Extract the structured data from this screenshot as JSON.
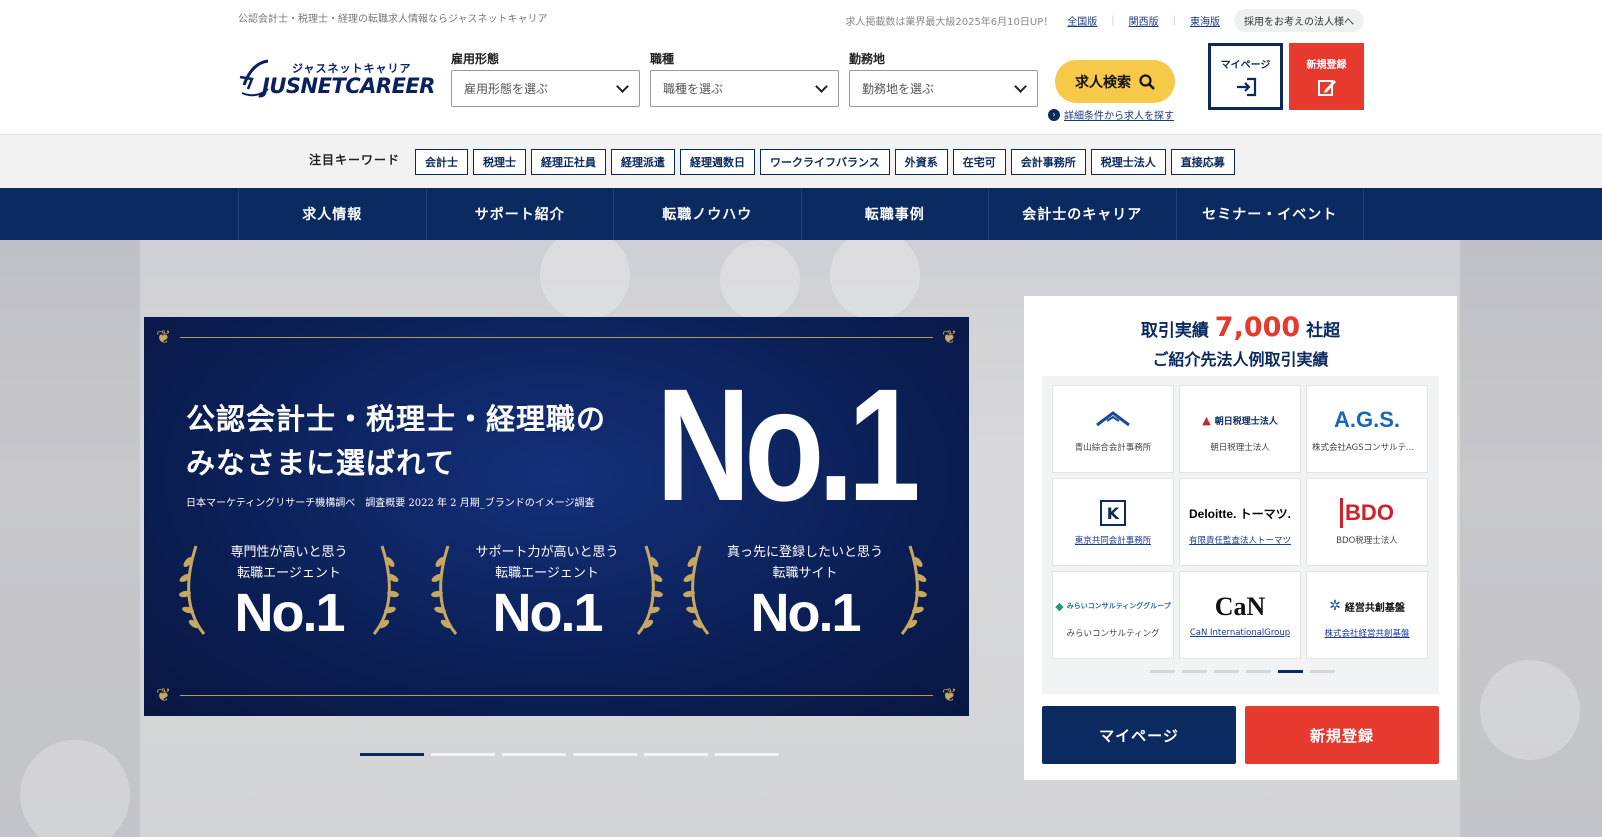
{
  "header": {
    "tagline": "公認会計士・税理士・経理の転職求人情報ならジャスネットキャリア",
    "notice": "求人掲載数は業界最大級2025年6月10日UP！",
    "region_links": [
      "全国版",
      "関西版",
      "東海版"
    ],
    "corporate_link": "採用をお考えの法人様へ",
    "logo_kana": "ジャスネットキャリア",
    "logo_en": "JUSNETCAREER"
  },
  "search": {
    "employment": {
      "label": "雇用形態",
      "value": "雇用形態を選ぶ"
    },
    "job": {
      "label": "職種",
      "value": "職種を選ぶ"
    },
    "location": {
      "label": "勤務地",
      "value": "勤務地を選ぶ"
    },
    "button": "求人検索",
    "detail_link": "詳細条件から求人を探す"
  },
  "account": {
    "mypage": "マイページ",
    "register": "新規登録"
  },
  "keywords": {
    "label": "注目キーワード",
    "items": [
      "会計士",
      "税理士",
      "経理正社員",
      "経理派遣",
      "経理週数日",
      "ワークライフバランス",
      "外資系",
      "在宅可",
      "会計事務所",
      "税理士法人",
      "直接応募"
    ]
  },
  "nav": {
    "items": [
      "求人情報",
      "サポート紹介",
      "転職ノウハウ",
      "転職事例",
      "会計士のキャリア",
      "セミナー・イベント"
    ]
  },
  "banner": {
    "headline_line1": "公認会計士・税理士・経理職の",
    "headline_line2": "みなさまに選ばれて",
    "big_no1": "No.1",
    "source": "日本マーケティングリサーチ機構調べ　調査概要 2022 年 2 月期_ブランドのイメージ調査",
    "awards": [
      {
        "line1": "専門性が高いと思う",
        "line2": "転職エージェント",
        "no1": "No.1"
      },
      {
        "line1": "サポート力が高いと思う",
        "line2": "転職エージェント",
        "no1": "No.1"
      },
      {
        "line1": "真っ先に登録したいと思う",
        "line2": "転職サイト",
        "no1": "No.1"
      }
    ],
    "slide_count": 6,
    "active_slide": 1
  },
  "panel": {
    "title_pre": "取引実績",
    "title_num": "7,000",
    "title_post": "社超",
    "subtitle": "ご紹介先法人例取引実績",
    "companies": [
      {
        "logo": "青山綜合会計事務所",
        "name": "青山綜合会計事務所",
        "link": false
      },
      {
        "logo": "朝日税理士法人",
        "name": "朝日税理士法人",
        "link": false
      },
      {
        "logo": "A.G.S.",
        "name": "株式会社AGSコンサルティング",
        "link": false
      },
      {
        "logo": "K",
        "name": "東京共同会計事務所",
        "link": true
      },
      {
        "logo": "Deloitte. トーマツ.",
        "name": "有限責任監査法人トーマツ",
        "link": true
      },
      {
        "logo": "BDO",
        "name": "BDO税理士法人",
        "link": false
      },
      {
        "logo": "みらいコンサルティンググループ",
        "name": "みらいコンサルティング",
        "link": false
      },
      {
        "logo": "CaN",
        "name": "CaN InternationalGroup",
        "link": true
      },
      {
        "logo": "経営共創基盤",
        "name": "株式会社経営共創基盤",
        "link": true
      }
    ],
    "carousel_count": 6,
    "carousel_active": 5,
    "mypage_button": "マイページ",
    "register_button": "新規登録"
  },
  "colors": {
    "navy": "#0b2a60",
    "red": "#e63a2e",
    "yellow": "#f7c948"
  }
}
